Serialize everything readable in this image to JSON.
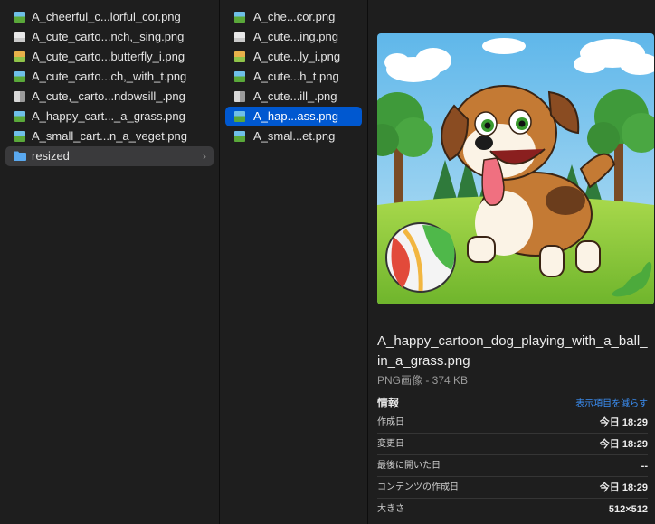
{
  "column1": {
    "items": [
      {
        "name": "A_cheerful_c...lorful_cor.png",
        "thumb": "meadow"
      },
      {
        "name": "A_cute_carto...nch,_sing.png",
        "thumb": "light"
      },
      {
        "name": "A_cute_carto...butterfly_i.png",
        "thumb": "warm"
      },
      {
        "name": "A_cute_carto...ch,_with_t.png",
        "thumb": "meadow"
      },
      {
        "name": "A_cute,_carto...ndowsill_.png",
        "thumb": "window"
      },
      {
        "name": "A_happy_cart..._a_grass.png",
        "thumb": "meadow"
      },
      {
        "name": "A_small_cart...n_a_veget.png",
        "thumb": "meadow"
      }
    ],
    "folder": {
      "name": "resized"
    }
  },
  "column2": {
    "items": [
      {
        "name": "A_che...cor.png",
        "thumb": "meadow"
      },
      {
        "name": "A_cute...ing.png",
        "thumb": "light"
      },
      {
        "name": "A_cute...ly_i.png",
        "thumb": "warm"
      },
      {
        "name": "A_cute...h_t.png",
        "thumb": "meadow"
      },
      {
        "name": "A_cute...ill_.png",
        "thumb": "window"
      },
      {
        "name": "A_hap...ass.png",
        "thumb": "meadow",
        "selected": true
      },
      {
        "name": "A_smal...et.png",
        "thumb": "meadow"
      }
    ]
  },
  "preview": {
    "file_name": "A_happy_cartoon_dog_playing_with_a_ball_in_a_grass.png",
    "file_type": "PNG画像 - 374 KB",
    "info_title": "情報",
    "show_less": "表示項目を減らす",
    "info": [
      {
        "label": "作成日",
        "value": "今日 18:29"
      },
      {
        "label": "変更日",
        "value": "今日 18:29"
      },
      {
        "label": "最後に開いた日",
        "value": "--"
      },
      {
        "label": "コンテンツの作成日",
        "value": "今日 18:29"
      },
      {
        "label": "大きさ",
        "value": "512×512"
      }
    ]
  },
  "colors": {
    "selection": "#0058d0",
    "folder_row": "#3a3a3c",
    "accent_link": "#3b8ff5",
    "folder_icon": "#5aa9f0"
  },
  "icons": {
    "image_file": "image-file-icon",
    "folder": "folder-icon",
    "chevron": "chevron-right-icon"
  }
}
